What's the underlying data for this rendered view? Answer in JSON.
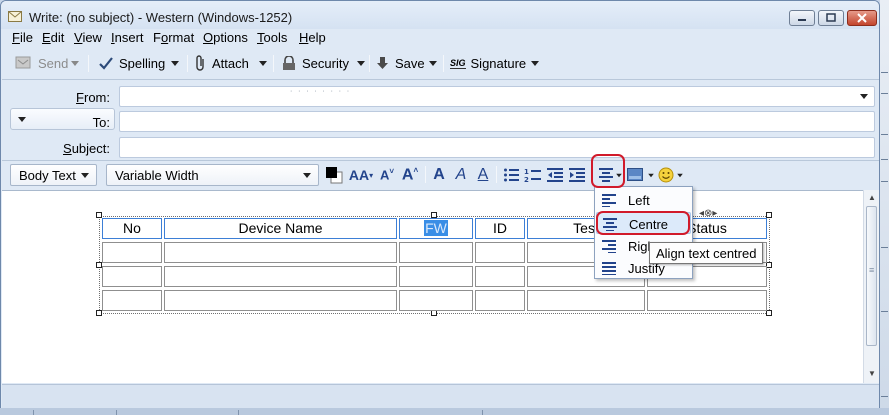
{
  "window": {
    "title": "Write: (no subject) - Western (Windows-1252)"
  },
  "menu": {
    "items": [
      {
        "label": "File",
        "key": "F",
        "rest": "ile"
      },
      {
        "label": "Edit",
        "key": "E",
        "rest": "dit"
      },
      {
        "label": "View",
        "key": "V",
        "rest": "iew"
      },
      {
        "label": "Insert",
        "key": "I",
        "rest": "nsert"
      },
      {
        "label": "Format",
        "pre": "F",
        "key": "o",
        "rest": "rmat"
      },
      {
        "label": "Options",
        "key": "O",
        "rest": "ptions"
      },
      {
        "label": "Tools",
        "key": "T",
        "rest": "ools"
      },
      {
        "label": "Help",
        "key": "H",
        "rest": "elp"
      }
    ]
  },
  "toolbar": {
    "send_label": "Send",
    "spelling_label": "Spelling",
    "attach_label": "Attach",
    "security_label": "Security",
    "save_label": "Save",
    "signature_label": "Signature",
    "signature_icon_text": "SIG"
  },
  "headers": {
    "from_label": "From:",
    "from_key": "F",
    "from_rest": "rom:",
    "to_label": "To:",
    "subject_label": "Subject:",
    "subject_key": "S",
    "subject_rest": "ubject:",
    "to_value": "",
    "subject_value": ""
  },
  "format": {
    "paragraph_style": "Body Text",
    "font": "Variable Width",
    "colors": {
      "text_color": "#000000",
      "background_color": "#ffffff"
    }
  },
  "table": {
    "headers": [
      "No",
      "Device Name",
      "FW",
      "ID",
      "Test",
      "Status"
    ],
    "selected_header": "FW",
    "rows": [
      [
        "",
        "",
        "",
        "",
        "",
        ""
      ],
      [
        "",
        "",
        "",
        "",
        "",
        ""
      ],
      [
        "",
        "",
        "",
        "",
        "",
        ""
      ]
    ]
  },
  "align_menu": {
    "items": [
      "Left",
      "Centre",
      "Right",
      "Justify"
    ],
    "highlighted": "Centre"
  },
  "tooltip": "Align text centred",
  "accent": {
    "highlight_red": "#d11a2a",
    "selection_blue": "#3a8ee6"
  }
}
